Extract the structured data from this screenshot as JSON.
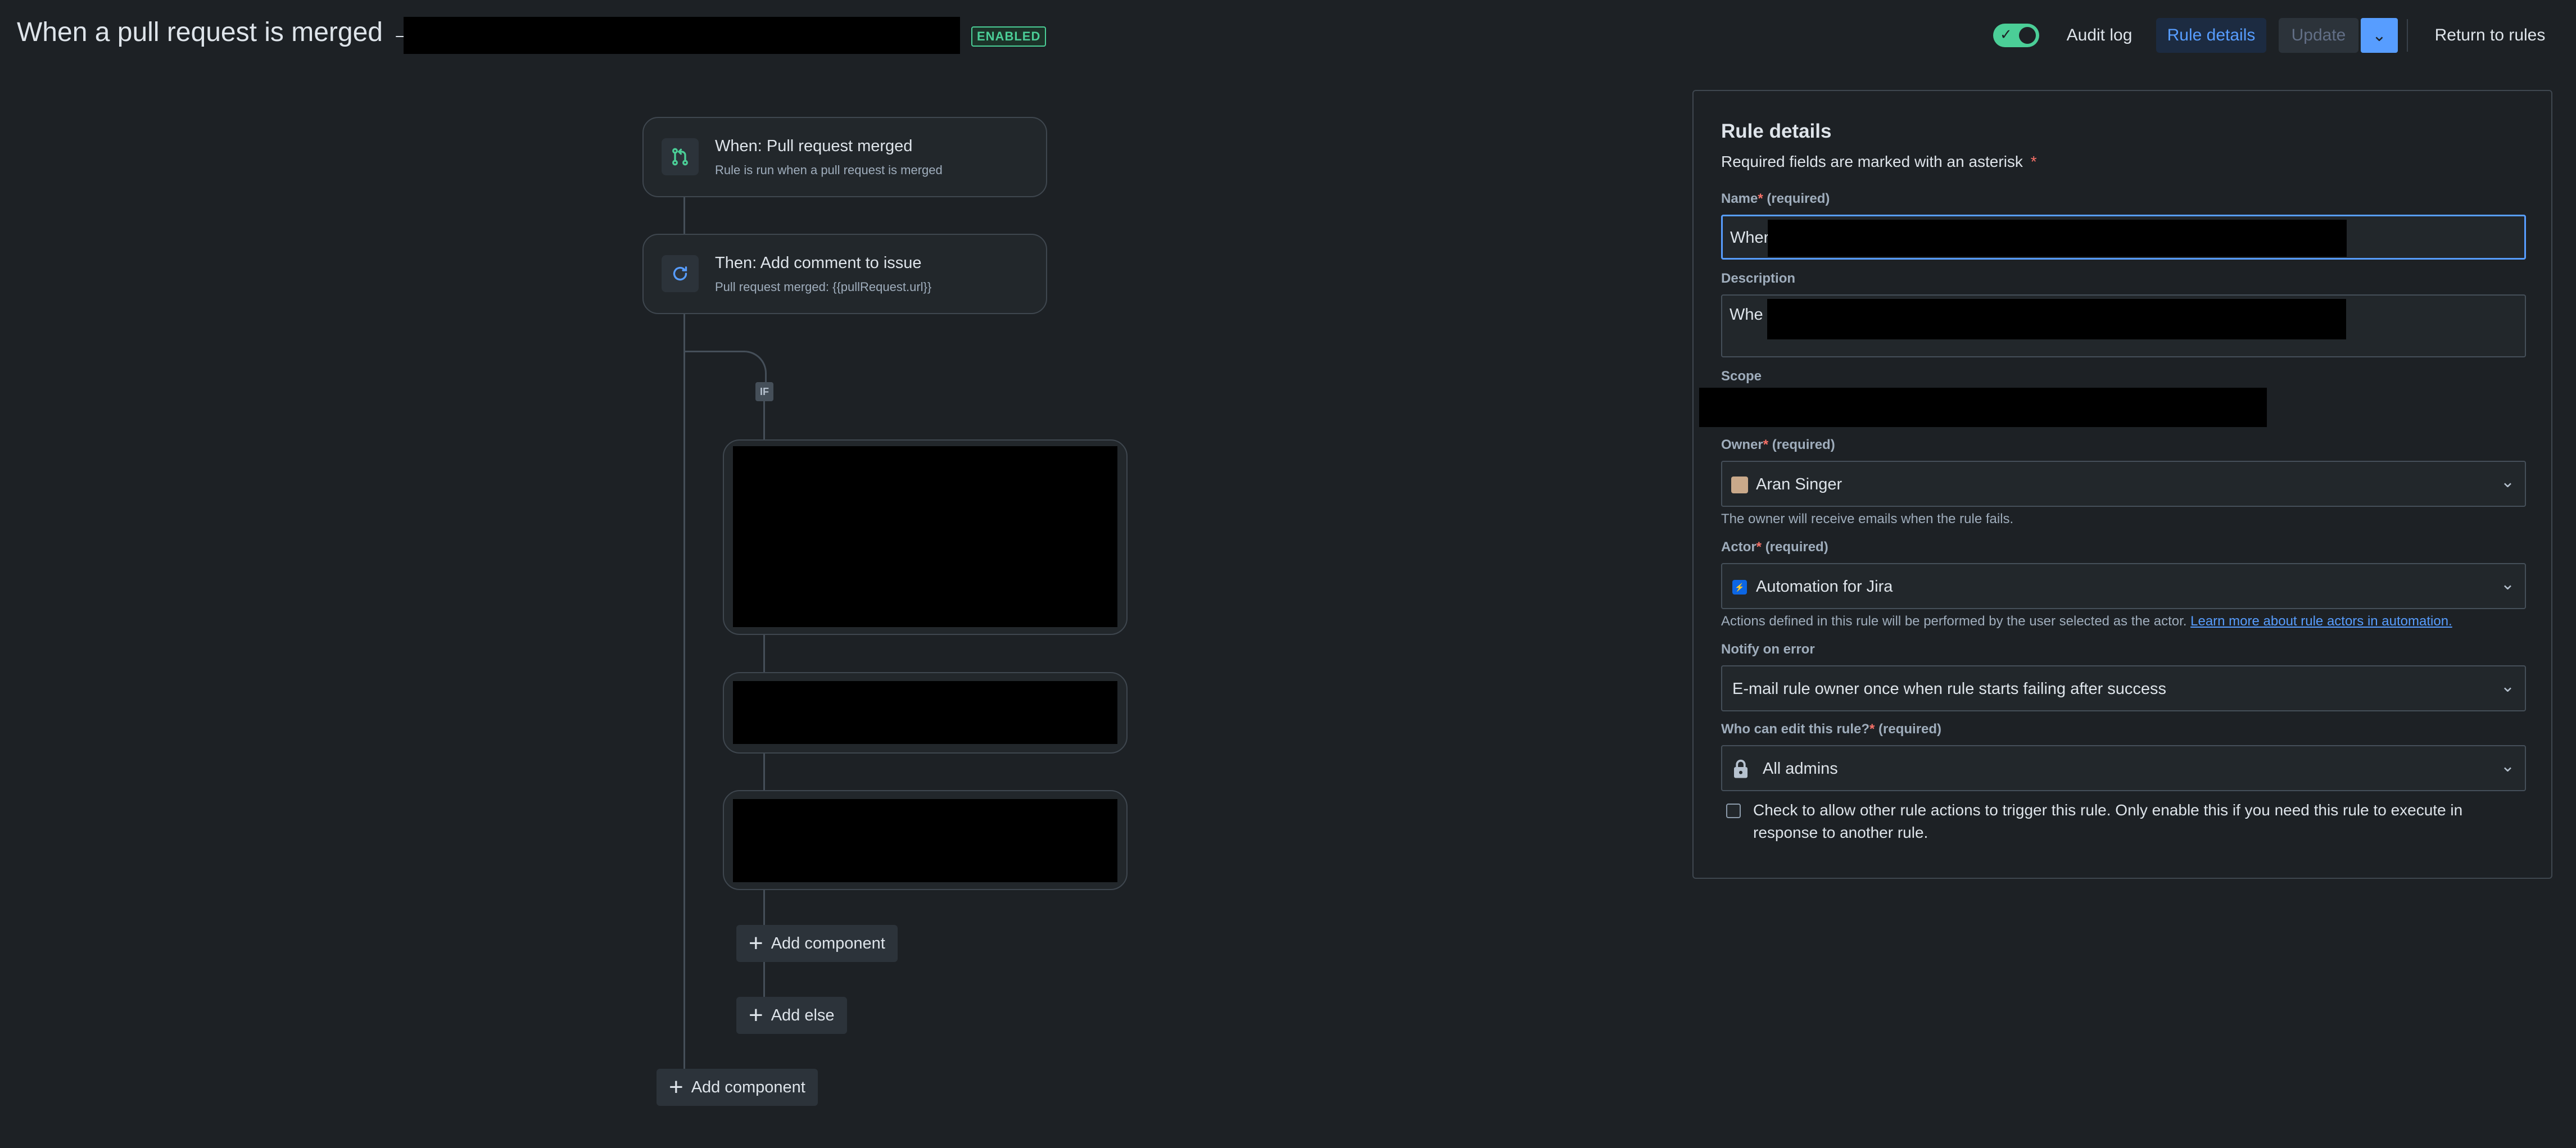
{
  "header": {
    "title": "When a pull request is merged →",
    "status_badge": "ENABLED",
    "toggle_on": true,
    "audit_log_label": "Audit log",
    "rule_details_label": "Rule details",
    "update_label": "Update",
    "return_label": "Return to rules"
  },
  "flow": {
    "trigger": {
      "title": "When: Pull request merged",
      "subtitle": "Rule is run when a pull request is merged",
      "icon": "git-pull-request-icon"
    },
    "action": {
      "title": "Then: Add comment to issue",
      "subtitle": "Pull request merged: {{pullRequest.url}}",
      "icon": "refresh-icon"
    },
    "if_badge": "IF",
    "add_component_inner": "Add component",
    "add_else": "Add else",
    "add_component_outer": "Add component"
  },
  "panel": {
    "heading": "Rule details",
    "required_note": "Required fields are marked with an asterisk",
    "required_marker": "*",
    "name": {
      "label": "Name",
      "suffix": "(required)",
      "value": "Wher"
    },
    "description": {
      "label": "Description",
      "value": "Whe"
    },
    "scope": {
      "label": "Scope"
    },
    "owner": {
      "label": "Owner",
      "suffix": "(required)",
      "value": "Aran Singer",
      "helper": "The owner will receive emails when the rule fails."
    },
    "actor": {
      "label": "Actor",
      "suffix": "(required)",
      "value": "Automation for Jira",
      "helper": "Actions defined in this rule will be performed by the user selected as the actor.",
      "link": "Learn more about rule actors in automation."
    },
    "notify": {
      "label": "Notify on error",
      "value": "E-mail rule owner once when rule starts failing after success"
    },
    "who_can_edit": {
      "label": "Who can edit this rule?",
      "suffix": "(required)",
      "value": "All admins"
    },
    "checkbox": {
      "checked": false,
      "line1": "Check to allow other rule actions to trigger this rule. Only enable this if you need this rule to execute in",
      "line2": "response to another rule."
    }
  },
  "colors": {
    "accent": "#579dff",
    "success": "#4bce97",
    "background": "#1d2125"
  }
}
